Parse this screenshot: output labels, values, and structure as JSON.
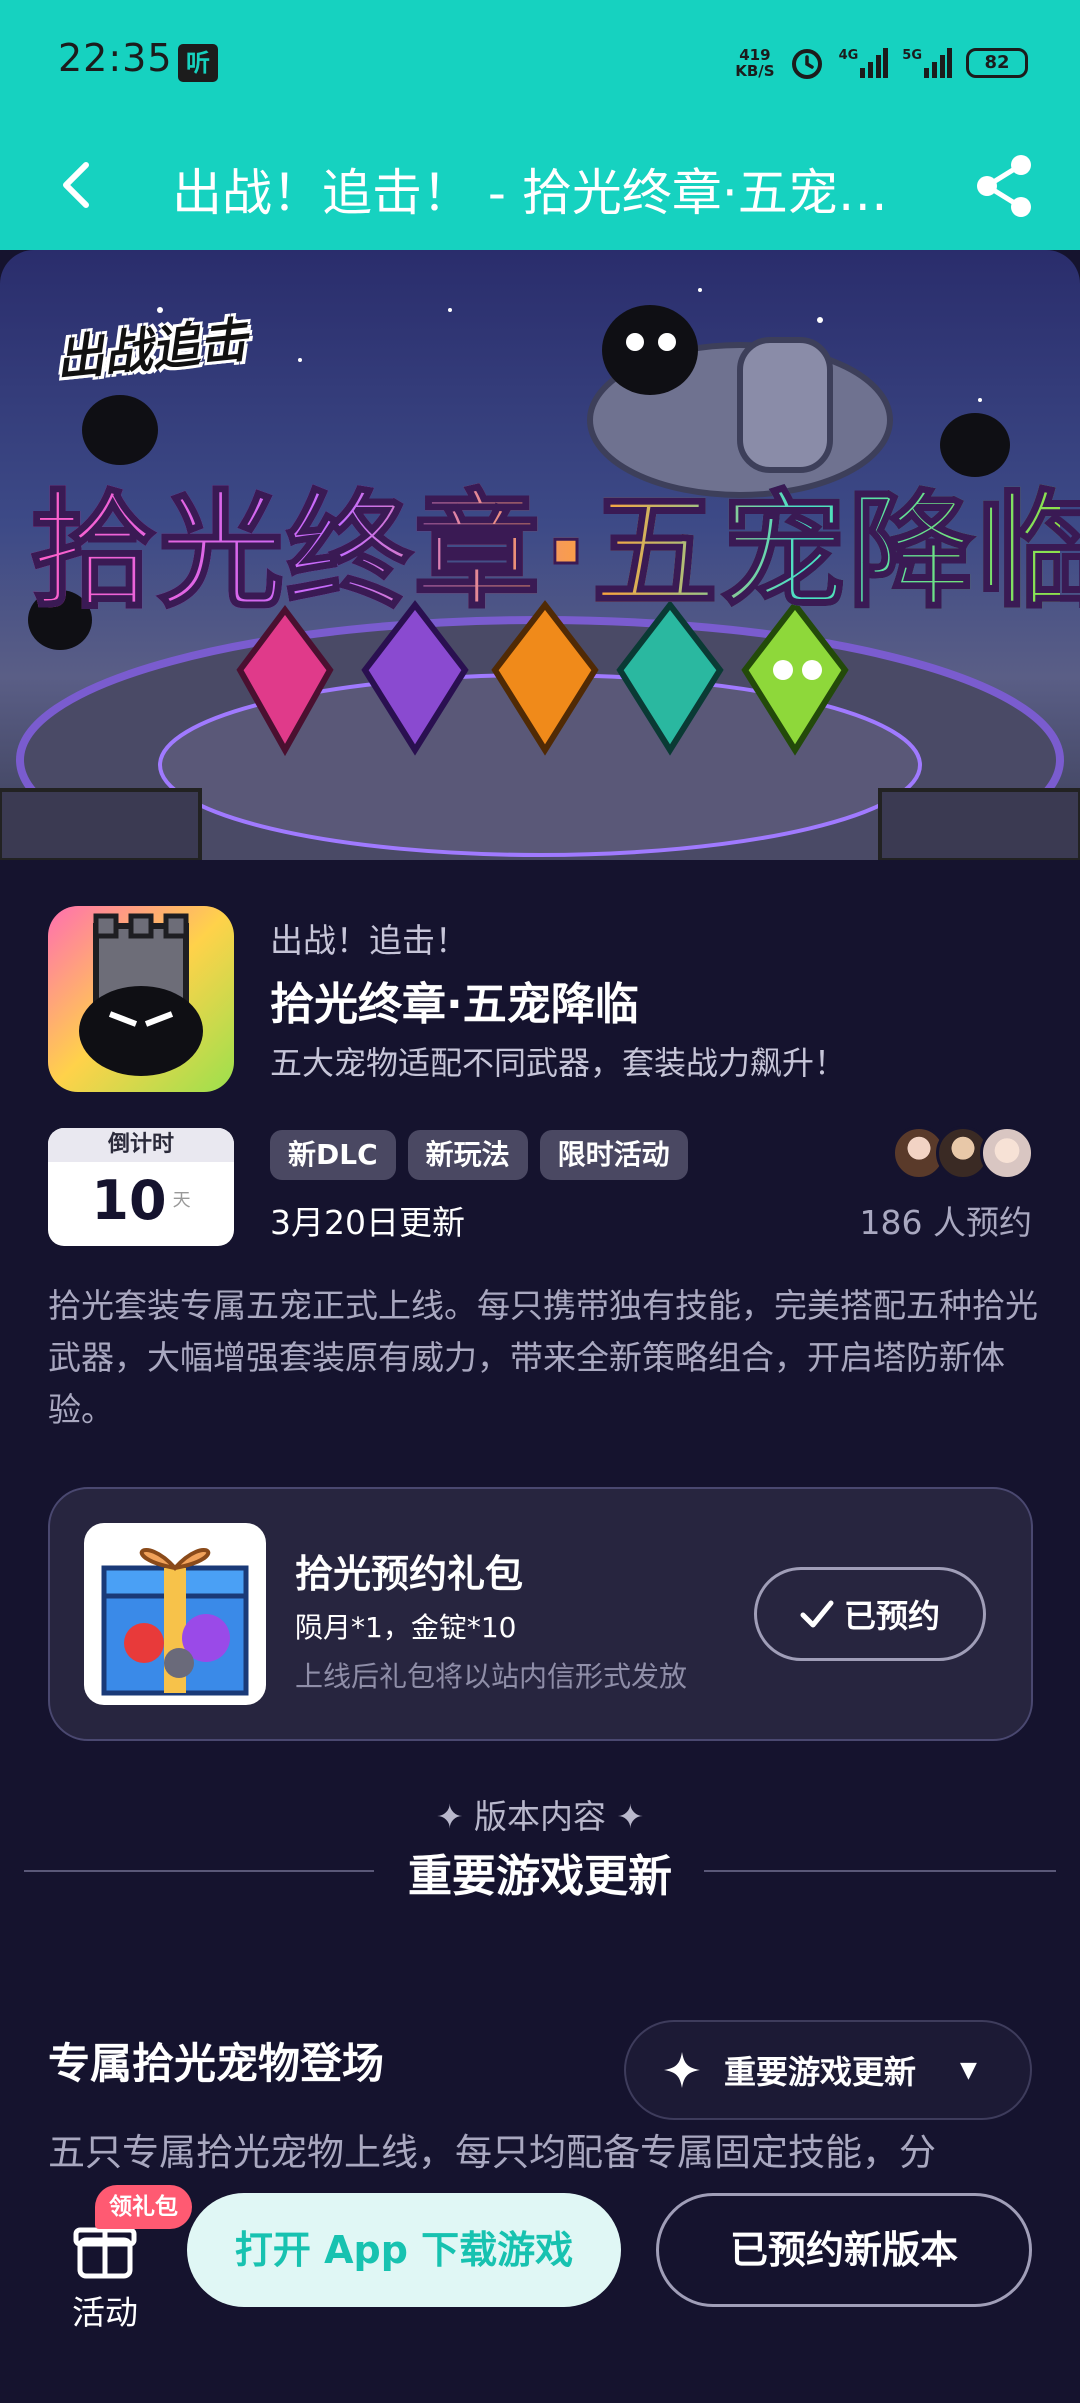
{
  "status_bar": {
    "time": "22:35",
    "listen_icon_text": "听",
    "net_speed_top": "419",
    "net_speed_bottom": "KB/S",
    "signal_1": "4G",
    "signal_2": "5G",
    "battery": "82"
  },
  "nav": {
    "title": "出战！追击！ - 拾光终章·五宠降临",
    "back_icon": "chevron-left-icon",
    "share_icon": "share-icon",
    "bar_color": "#16d2c0"
  },
  "banner": {
    "logo_text": "出战追击",
    "title_text": "拾光终章·五宠降临"
  },
  "game": {
    "name": "出战！追击！",
    "update_title": "拾光终章·五宠降临",
    "update_subtitle": "五大宠物适配不同武器，套装战力飙升！",
    "countdown_label": "倒计时",
    "countdown_value": "10",
    "countdown_unit": "天",
    "tags": [
      "新DLC",
      "新玩法",
      "限时活动"
    ],
    "update_date": "3月20日更新",
    "reserve_count": "186 人预约",
    "description": "拾光套装专属五宠正式上线。每只携带独有技能，完美搭配五种拾光武器，大幅增强套装原有威力，带来全新策略组合，开启塔防新体验。"
  },
  "gift": {
    "title": "拾光预约礼包",
    "items": "陨月*1，金锭*10",
    "note": "上线后礼包将以站内信形式发放",
    "button_label": "已预约"
  },
  "section": {
    "kicker": "✦ 版本内容 ✦",
    "title": "重要游戏更新"
  },
  "content": {
    "pet_title": "专属拾光宠物登场",
    "pet_desc": "五只专属拾光宠物上线，每只均配备专属固定技能，分",
    "dropdown_label": "重要游戏更新"
  },
  "bottom": {
    "activity_label": "活动",
    "gift_badge": "领礼包",
    "open_app_label": "打开 App 下载游戏",
    "reserved_version_label": "已预约新版本"
  },
  "colors": {
    "background": "#15132e",
    "accent": "#16d2c0",
    "badge": "#ff5a72"
  }
}
